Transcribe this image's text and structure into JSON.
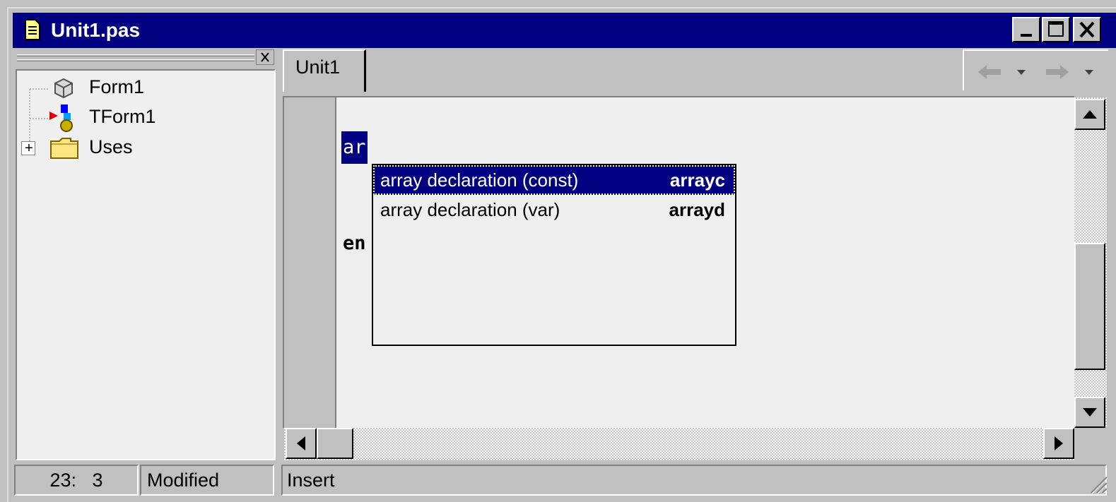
{
  "window": {
    "title": "Unit1.pas"
  },
  "tree": {
    "items": [
      "Form1",
      "TForm1",
      "Uses"
    ],
    "expand_glyph": "+"
  },
  "tabs": [
    {
      "label": "Unit1"
    }
  ],
  "editor": {
    "typed_text": "ar",
    "partial_line": "en"
  },
  "completion": {
    "items": [
      {
        "description": "array declaration (const)",
        "keyword": "arrayc",
        "selected": true
      },
      {
        "description": "array declaration (var)",
        "keyword": "arrayd",
        "selected": false
      }
    ]
  },
  "statusbar": {
    "position": "23:   3",
    "modified": "Modified",
    "mode": "Insert"
  },
  "colors": {
    "titlebar": "#000080",
    "selection": "#000080",
    "face": "#c0c0c0"
  }
}
